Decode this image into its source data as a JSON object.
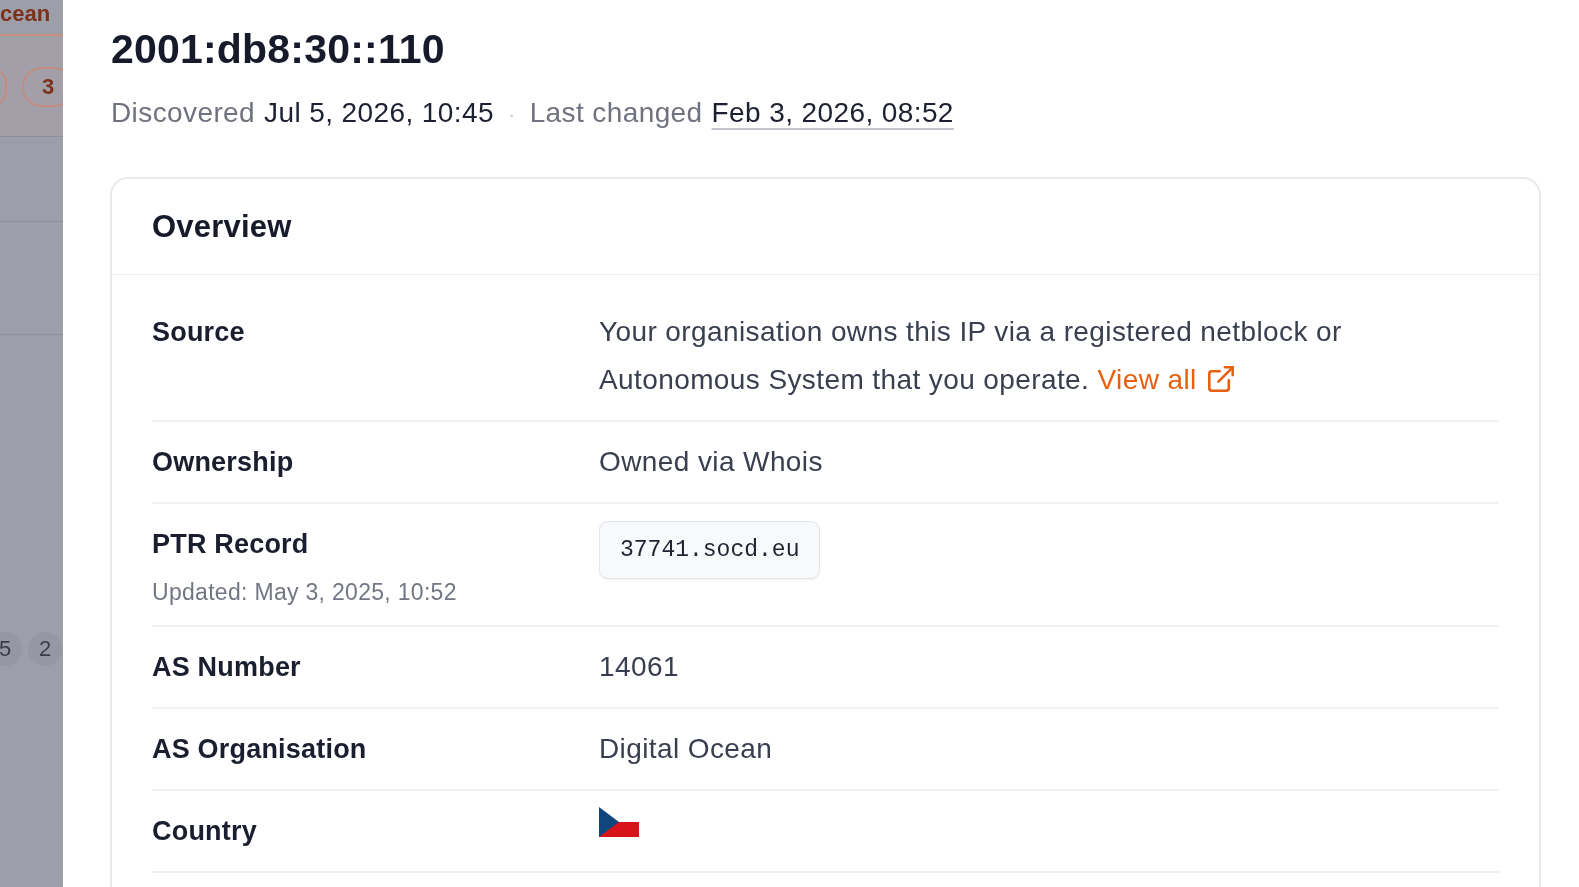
{
  "background_page": {
    "tab_label": "cean",
    "chips": [
      "3"
    ],
    "counts": [
      "5",
      "2"
    ]
  },
  "drawer": {
    "title": "2001:db8:30::110",
    "meta": {
      "discovered_label": "Discovered",
      "discovered": "Jul 5, 2026, 10:45",
      "separator": "·",
      "changed_label": "Last changed",
      "changed": "Feb 3, 2026, 08:52"
    },
    "overview": {
      "title": "Overview",
      "rows": [
        {
          "kind": "text",
          "label": "Source",
          "value": "Your organisation owns this IP via a registered netblock or Autonomous System that you operate.",
          "link": "View all"
        },
        {
          "kind": "text",
          "label": "Ownership",
          "value": "Owned via Whois"
        },
        {
          "kind": "code",
          "label": "PTR Record",
          "note": "Updated: May 3, 2025, 10:52",
          "value": "37741.socd.eu"
        },
        {
          "kind": "text",
          "label": "AS Number",
          "value": "14061"
        },
        {
          "kind": "text",
          "label": "AS Organisation",
          "value": "Digital Ocean"
        },
        {
          "kind": "flag",
          "label": "Country"
        }
      ]
    }
  }
}
